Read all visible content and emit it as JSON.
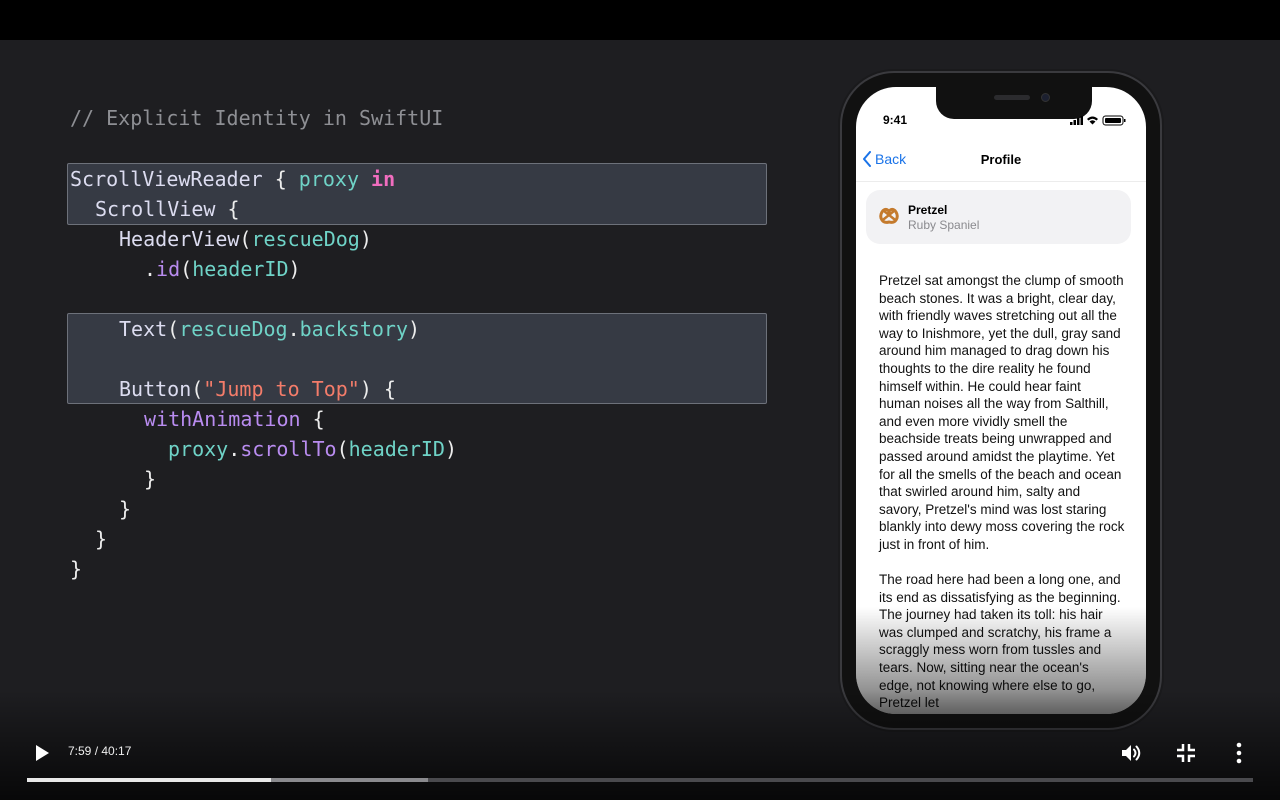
{
  "slide": {
    "comment": "// Explicit Identity in SwiftUI",
    "code": {
      "l1_type": "ScrollViewReader",
      "l1_brace": " { ",
      "l1_var": "proxy",
      "l1_kw": " in",
      "l2_type": "ScrollView",
      "l2_brace": " {",
      "l3_type": "HeaderView",
      "l3_open": "(",
      "l3_var": "rescueDog",
      "l3_close": ")",
      "l4_dot": ".",
      "l4_fn": "id",
      "l4_open": "(",
      "l4_var": "headerID",
      "l4_close": ")",
      "l6_type": "Text",
      "l6_open": "(",
      "l6_var1": "rescueDog",
      "l6_dot": ".",
      "l6_var2": "backstory",
      "l6_close": ")",
      "l8_type": "Button",
      "l8_open": "(",
      "l8_str": "\"Jump to Top\"",
      "l8_close": ") {",
      "l9_fn": "withAnimation",
      "l9_brace": " {",
      "l10_var1": "proxy",
      "l10_dot": ".",
      "l10_fn": "scrollTo",
      "l10_open": "(",
      "l10_var2": "headerID",
      "l10_close": ")",
      "l11": "}",
      "l12": "}",
      "l13": "}",
      "l14": "}"
    }
  },
  "phone": {
    "time": "9:41",
    "back_label": "Back",
    "title": "Profile",
    "card": {
      "name": "Pretzel",
      "breed": "Ruby Spaniel"
    },
    "paragraph1": "Pretzel sat amongst the clump of smooth beach stones. It was a bright, clear day, with friendly waves stretching out all the way to Inishmore, yet the dull, gray sand around him managed to drag down his thoughts to the dire reality he found himself within. He could hear faint human noises all the way from Salthill, and even more vividly smell the beachside treats being unwrapped and passed around amidst the playtime. Yet for all the smells of the beach and ocean that swirled around him, salty and savory, Pretzel's mind was lost staring blankly into dewy moss covering the rock just in front of him.",
    "paragraph2": "The road here had been a long one, and its end as dissatisfying as the beginning. The journey had taken its toll: his hair was clumped and scratchy, his frame a scraggly mess worn from tussles and tears. Now, sitting near the ocean's edge, not knowing where else to go, Pretzel let"
  },
  "player": {
    "time_display": "7:59 / 40:17",
    "progress_fraction": 0.199,
    "buffered_fraction": 0.327,
    "icons": [
      "play-icon",
      "volume-icon",
      "exit-fullscreen-icon",
      "more-options-icon"
    ],
    "colors": {
      "accent": "#1a73e8",
      "played": "#e8e8e8"
    }
  }
}
